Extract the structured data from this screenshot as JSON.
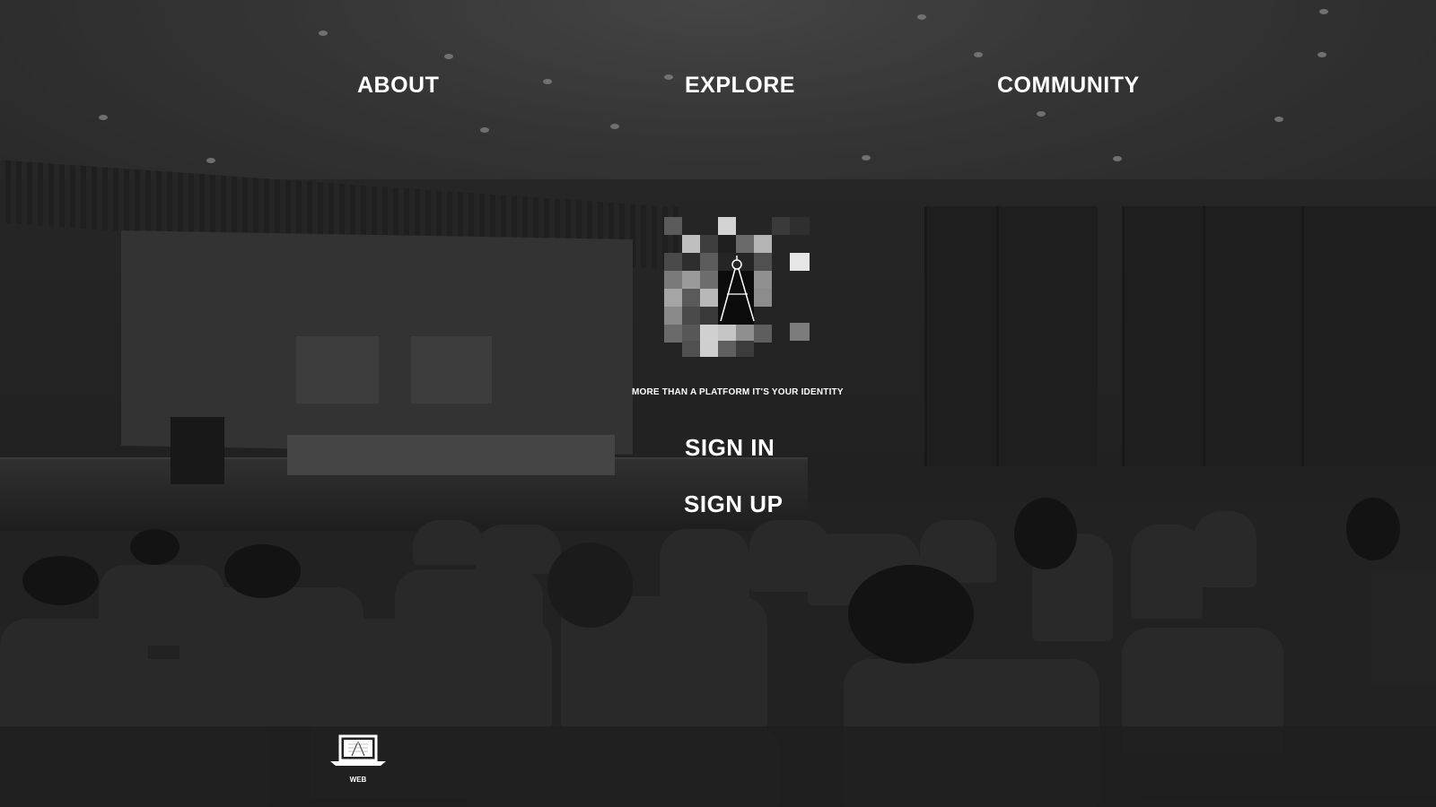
{
  "nav": {
    "about": "ABOUT",
    "explore": "EXPLORE",
    "community": "COMMUNITY"
  },
  "hero": {
    "tagline": "MORE THAN A PLATFORM IT'S YOUR IDENTITY",
    "logo_icon": "pixel-compass-logo"
  },
  "auth": {
    "sign_in": "SIGN IN",
    "sign_up": "SIGN UP"
  },
  "footer": {
    "web_label": "WEB",
    "web_icon": "laptop-icon"
  },
  "colors": {
    "text": "#ffffff",
    "overlay": "#000000"
  }
}
